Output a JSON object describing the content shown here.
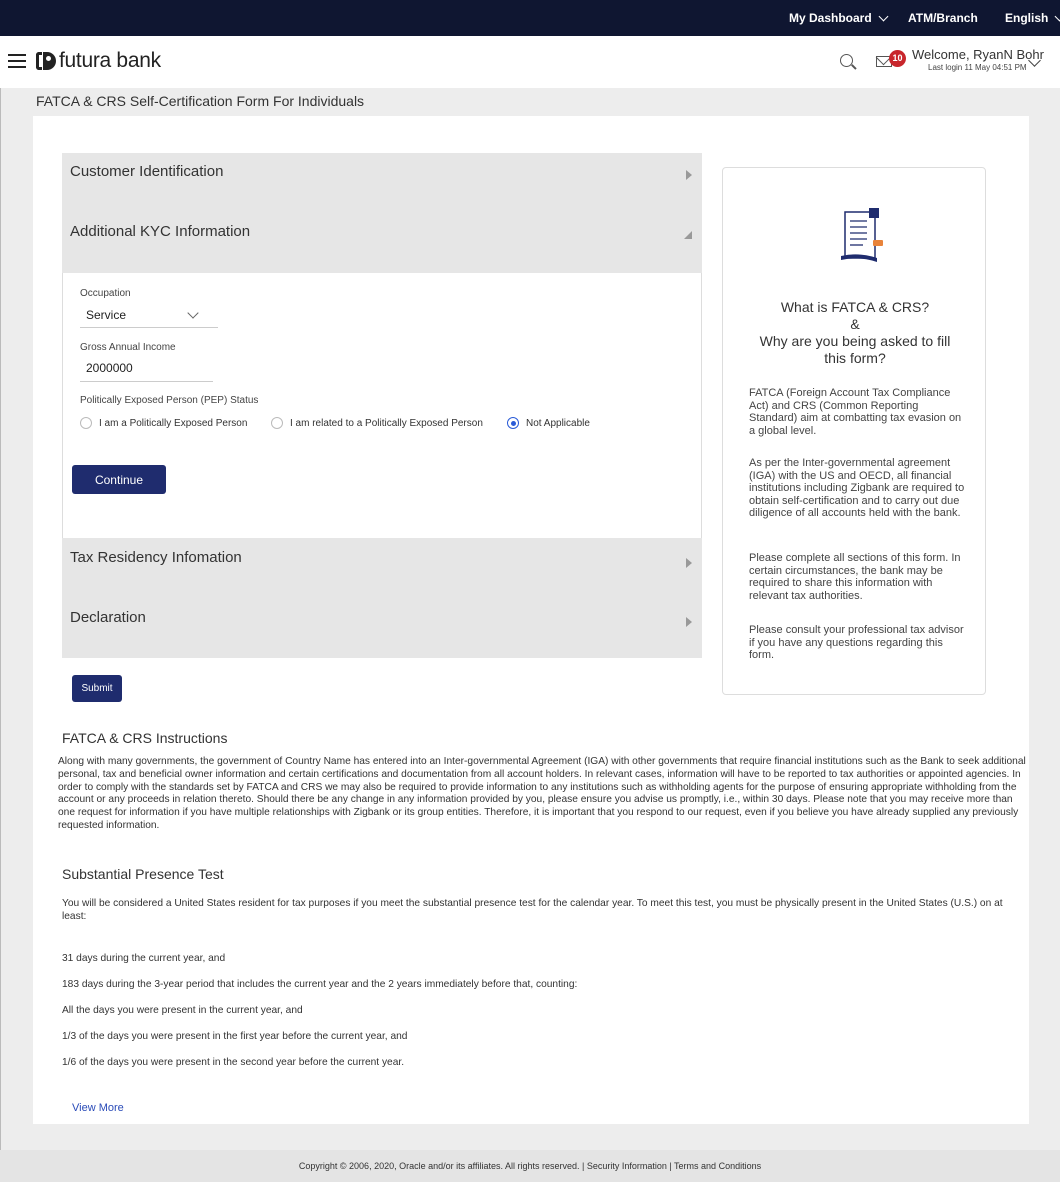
{
  "topbar": {
    "dashboard": "My Dashboard",
    "atm": "ATM/Branch",
    "language": "English"
  },
  "header": {
    "brand": "futura bank",
    "notifications": "10",
    "welcome": "Welcome, RyanN Bohr",
    "last_login": "Last login 11 May 04:51 PM"
  },
  "page": {
    "title": "FATCA & CRS Self-Certification Form For Individuals"
  },
  "sections": {
    "customer_identification": "Customer Identification",
    "additional_kyc": "Additional KYC Information",
    "tax_residency": "Tax Residency Infomation",
    "declaration": "Declaration"
  },
  "kyc_form": {
    "occupation_label": "Occupation",
    "occupation_value": "Service",
    "income_label": "Gross Annual Income",
    "income_value": "2000000",
    "pep_label": "Politically Exposed Person (PEP) Status",
    "pep_options": [
      {
        "label": "I am a Politically Exposed Person",
        "selected": false
      },
      {
        "label": "I am related to a Politically Exposed Person",
        "selected": false
      },
      {
        "label": "Not Applicable",
        "selected": true
      }
    ],
    "continue_label": "Continue"
  },
  "submit_label": "Submit",
  "sidebar": {
    "heading_1": "What is FATCA & CRS?",
    "heading_2": "&",
    "heading_3": "Why are you being asked to fill",
    "heading_4": "this form?",
    "p1": "FATCA (Foreign Account Tax Compliance Act) and CRS (Common Reporting Standard) aim at combatting tax evasion on a global level.",
    "p2": "As per the Inter-governmental agreement (IGA) with the US and OECD, all financial institutions including Zigbank are required to obtain self-certification and to carry out due diligence of all accounts held with the bank.",
    "p3": "Please complete all sections of this form. In certain circumstances, the bank may be required to share this information with relevant tax authorities.",
    "p4": "Please consult your professional tax advisor if you have any questions regarding this form."
  },
  "instructions": {
    "heading": "FATCA & CRS Instructions",
    "body": "Along with many governments, the government of Country Name has entered into an Inter-governmental Agreement (IGA) with other governments that require financial institutions such as the Bank to seek additional personal, tax and beneficial owner information and certain certifications and documentation from all account holders. In relevant cases, information will have to be reported to tax authorities or appointed agencies. In order to comply with the standards set by FATCA and CRS we may also be required to provide information to any institutions such as withholding agents for the purpose of ensuring appropriate withholding from the account or any proceeds in relation thereto. Should there be any change in any information provided by you, please ensure you advise us promptly, i.e., within 30 days. Please note that you may receive more than one request for information if you have multiple relationships with Zigbank or its group entities. Therefore, it is important that you respond to our request, even if you believe you have already supplied any previously requested information."
  },
  "presence": {
    "heading": "Substantial Presence Test",
    "intro": "You will be considered a United States resident for tax purposes if you meet the substantial presence test for the calendar year. To meet this test, you must be physically present in the United States (U.S.) on at least:",
    "l1": "31 days during the current year, and",
    "l2": "183 days during the 3-year period that includes the current year and the 2 years immediately before that, counting:",
    "l3": "All the days you were present in the current year, and",
    "l4": "1/3 of the days you were present in the first year before the current year, and",
    "l5": "1/6 of the days you were present in the second year before the current year."
  },
  "view_more": "View More",
  "footer": {
    "copyright": "Copyright © 2006, 2020, Oracle and/or its affiliates. All rights reserved. | Security Information | Terms and Conditions"
  }
}
